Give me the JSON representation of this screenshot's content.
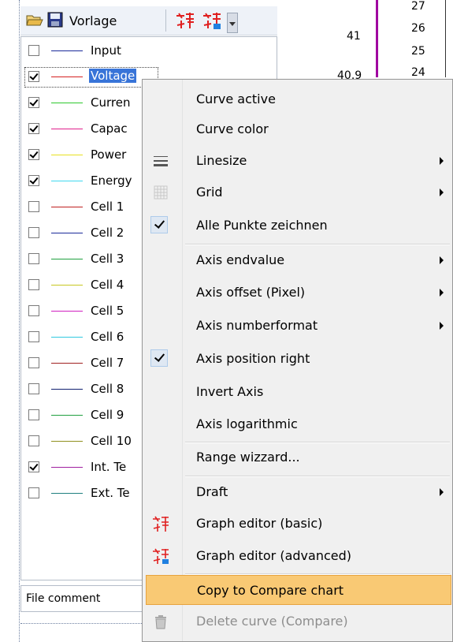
{
  "toolbar": {
    "vorlage_label": "Vorlage"
  },
  "curves": [
    {
      "label": "Input",
      "color": "#1a2a9a",
      "checked": false
    },
    {
      "label": "Voltage",
      "color": "#d42020",
      "checked": true,
      "selected": true
    },
    {
      "label": "Curren",
      "color": "#2ec82e",
      "checked": true
    },
    {
      "label": "Capac",
      "color": "#e0208c",
      "checked": true
    },
    {
      "label": "Power",
      "color": "#e8e020",
      "checked": true
    },
    {
      "label": "Energy",
      "color": "#40d8f0",
      "checked": true
    },
    {
      "label": "Cell 1",
      "color": "#c02020",
      "checked": false
    },
    {
      "label": "Cell 2",
      "color": "#1a2a9a",
      "checked": false
    },
    {
      "label": "Cell 3",
      "color": "#20a040",
      "checked": false
    },
    {
      "label": "Cell 4",
      "color": "#c8c820",
      "checked": false
    },
    {
      "label": "Cell 5",
      "color": "#d020c0",
      "checked": false
    },
    {
      "label": "Cell 6",
      "color": "#30c8e0",
      "checked": false
    },
    {
      "label": "Cell 7",
      "color": "#a02020",
      "checked": false
    },
    {
      "label": "Cell 8",
      "color": "#102070",
      "checked": false
    },
    {
      "label": "Cell 9",
      "color": "#20a040",
      "checked": false
    },
    {
      "label": "Cell 10",
      "color": "#909020",
      "checked": false
    },
    {
      "label": "Int. Te",
      "color": "#a020a0",
      "checked": true
    },
    {
      "label": "Ext. Te",
      "color": "#208080",
      "checked": false
    }
  ],
  "file_comment": "File comment",
  "chart": {
    "ticks_a": [
      "41",
      "40.9"
    ],
    "ticks_b": [
      "27",
      "26",
      "25",
      "24"
    ]
  },
  "menu": {
    "curve_active": "Curve active",
    "curve_color": "Curve color",
    "linesize": "Linesize",
    "grid": "Grid",
    "alle_punkte": "Alle Punkte zeichnen",
    "axis_endvalue": "Axis endvalue",
    "axis_offset": "Axis offset (Pixel)",
    "axis_numberformat": "Axis numberformat",
    "axis_position_right": "Axis position right",
    "invert_axis": "Invert Axis",
    "axis_logarithmic": "Axis logarithmic",
    "range_wizzard": "Range wizzard...",
    "draft": "Draft",
    "graph_editor_basic": "Graph editor (basic)",
    "graph_editor_advanced": "Graph editor (advanced)",
    "copy_to_compare": "Copy to Compare chart",
    "delete_curve": "Delete curve (Compare)"
  }
}
